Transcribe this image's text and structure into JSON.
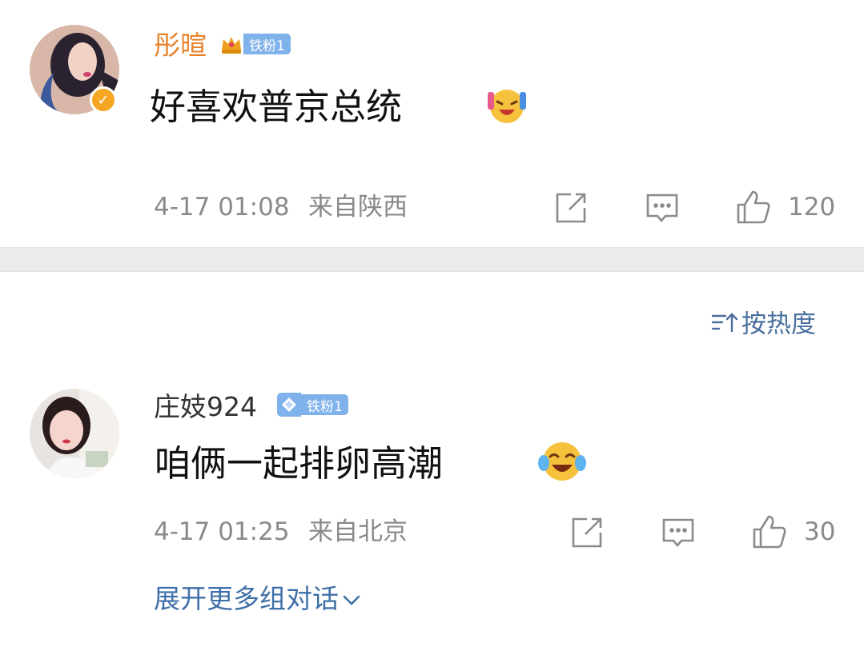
{
  "comments": [
    {
      "username": "彤暄",
      "username_color": "#e7832b",
      "fan_badge": "铁粉1",
      "verified": true,
      "text": "好喜欢普京总统",
      "emoji": "excited-face-emoji",
      "date": "4-17 01:08",
      "location": "来自陕西",
      "likes": "120"
    },
    {
      "username": "庄妓924",
      "username_color": "#333333",
      "fan_badge": "铁粉1",
      "verified": false,
      "text": "咱俩一起排卵高潮",
      "emoji": "laughing-tears-emoji",
      "date": "4-17 01:25",
      "location": "来自北京",
      "likes": "30"
    }
  ],
  "sort_label": "按热度",
  "expand_label": "展开更多组对话",
  "colors": {
    "meta_gray": "#8a8a8a",
    "link_blue": "#3f6fa8",
    "badge_blue": "#7fb2ea",
    "verify_gold": "#f5a623"
  }
}
